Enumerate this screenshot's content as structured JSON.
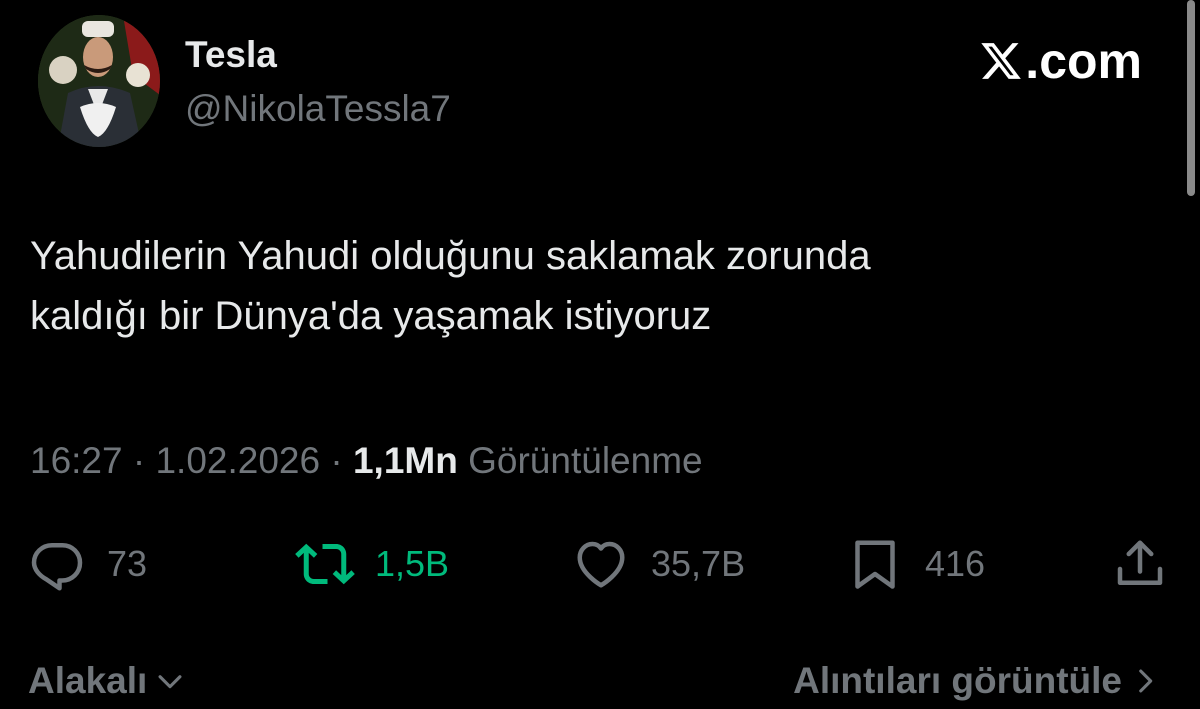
{
  "author": {
    "display_name": "Tesla",
    "handle": "@NikolaTessla7",
    "avatar_icon": "profile-photo"
  },
  "brand": {
    "logo_icon": "x-logo-icon",
    "suffix": ".com"
  },
  "tweet": {
    "text_lines": [
      "Yahudilerin Yahudi olduğunu saklamak zorunda",
      "kaldığı bir Dünya'da yaşamak istiyoruz"
    ],
    "time": "16:27",
    "date": "1.02.2026",
    "separator": "·",
    "views_count": "1,1Mn",
    "views_label": "Görüntülenme"
  },
  "actions": {
    "replies": "73",
    "retweets": "1,5B",
    "likes": "35,7B",
    "bookmarks": "416",
    "retweet_color": "#00ba7c"
  },
  "footer": {
    "sort_label": "Alakalı",
    "quotes_label": "Alıntıları görüntüle"
  }
}
